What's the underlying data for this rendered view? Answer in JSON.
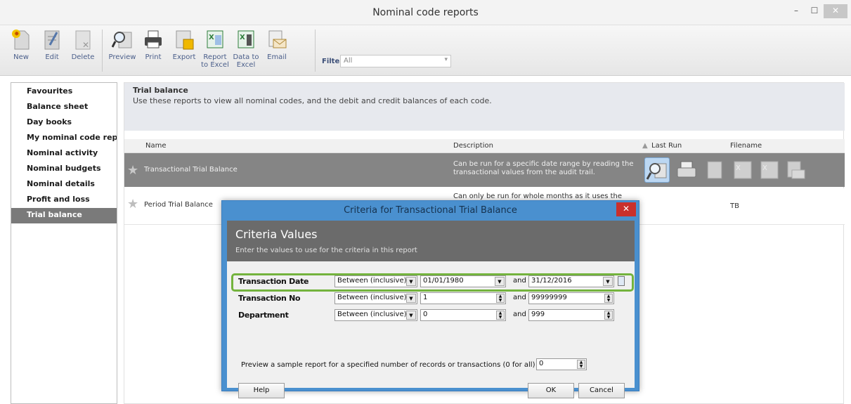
{
  "window": {
    "title": "Nominal code reports",
    "buttons": {
      "minimize": "–",
      "maximize": "☐",
      "close": "✕"
    }
  },
  "toolbar": {
    "buttons": [
      {
        "label": "New",
        "icon": "new-icon"
      },
      {
        "label": "Edit",
        "icon": "edit-icon"
      },
      {
        "label": "Delete",
        "icon": "delete-icon"
      },
      {
        "label": "Preview",
        "icon": "preview-icon"
      },
      {
        "label": "Print",
        "icon": "print-icon"
      },
      {
        "label": "Export",
        "icon": "export-icon"
      },
      {
        "label": "Report to Excel",
        "icon": "report-excel-icon"
      },
      {
        "label": "Data to Excel",
        "icon": "data-excel-icon"
      },
      {
        "label": "Email",
        "icon": "email-icon"
      }
    ],
    "filters_label": "Filters",
    "filters_value": "All"
  },
  "sidebar": {
    "items": [
      {
        "label": "Favourites"
      },
      {
        "label": "Balance sheet"
      },
      {
        "label": "Day books"
      },
      {
        "label": "My nominal code rep"
      },
      {
        "label": "Nominal activity"
      },
      {
        "label": "Nominal budgets"
      },
      {
        "label": "Nominal details"
      },
      {
        "label": "Profit and loss"
      },
      {
        "label": "Trial balance",
        "selected": true
      }
    ]
  },
  "main": {
    "heading": "Trial balance",
    "description": "Use these reports to view all nominal codes, and the debit and credit balances of each code.",
    "columns": {
      "name": "Name",
      "description": "Description",
      "last_run": "Last Run",
      "filename": "Filename"
    },
    "rows": [
      {
        "name": "Transactional Trial Balance",
        "description": "Can be run for a specific date range by reading the transactional values from the audit trail.",
        "last_run": "",
        "filename": ""
      },
      {
        "name": "Period Trial Balance",
        "description": "Can only be run for whole months as it uses the nominal",
        "last_run": "",
        "filename": "TB"
      }
    ]
  },
  "dialog": {
    "title": "Criteria for Transactional Trial Balance",
    "close": "✕",
    "heading": "Criteria Values",
    "subheading": "Enter the values to use for the criteria in this report",
    "criteria": [
      {
        "label": "Transaction Date",
        "operator": "Between (inclusive)",
        "from": "01/01/1980",
        "and": "and",
        "to": "31/12/2016"
      },
      {
        "label": "Transaction No",
        "operator": "Between (inclusive)",
        "from": "1",
        "and": "and",
        "to": "99999999"
      },
      {
        "label": "Department",
        "operator": "Between (inclusive)",
        "from": "0",
        "and": "and",
        "to": "999"
      }
    ],
    "preview_text": "Preview a sample report for a specified number of records or transactions (0 for all)",
    "preview_value": "0",
    "buttons": {
      "help": "Help",
      "ok": "OK",
      "cancel": "Cancel"
    }
  },
  "colors": {
    "highlight": "#73b33d",
    "dialog_frame": "#4a90cf",
    "selected_row": "#858585"
  }
}
